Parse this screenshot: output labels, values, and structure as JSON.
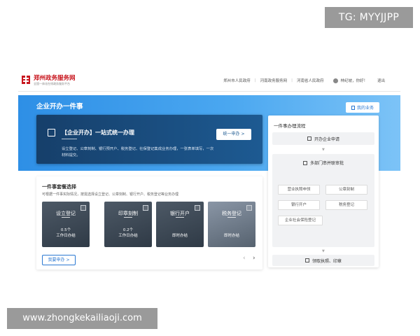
{
  "watermarks": {
    "top": "TG: MYYJJPP",
    "bottom": "www.zhongkekailiaoji.com"
  },
  "header": {
    "logo_title": "郑州政务服务网",
    "logo_sub": "全国一体化在线政务服务平台",
    "links": [
      "郑州市人民政府",
      "河南政务服务网",
      "河南省人民政府"
    ],
    "user_greeting": "林纪坡，你好！",
    "logout": "退出"
  },
  "banner": {
    "title": "企业开办一件事",
    "my_business": "我的业务"
  },
  "onestop": {
    "title": "【企业开办】一站式统一办理",
    "desc": "设立登记、公章刻制、银行预开户、税务登记、社保登记集成业务办理，一张表单填写，一次材料提交。",
    "button": "统一申办 >"
  },
  "packages": {
    "title": "一件事套餐选择",
    "subtitle": "可根据一件事实际情况，按需选择设立登记、公章刻制、银行开户、税务登记等业务办理",
    "cards": [
      {
        "name": "设立登记",
        "count": "0.5个",
        "time": "工作日办结"
      },
      {
        "name": "印章刻制",
        "count": "0.2个",
        "time": "工作日办结"
      },
      {
        "name": "银行开户",
        "count": "",
        "time": "即时办结"
      },
      {
        "name": "税务登记",
        "count": "",
        "time": "即时办结"
      }
    ],
    "apply_button": "我要申办 >",
    "prev": "‹",
    "next": "›"
  },
  "flow": {
    "title": "一件事办理流程",
    "step1": "开办企业申请",
    "step2": "多部门串并联审批",
    "items": [
      "营业执照申领",
      "公章刻制",
      "银行开户",
      "税务登记",
      "企业社会保险登记"
    ],
    "step3": "领取执照、印章",
    "arrow": "▼"
  }
}
